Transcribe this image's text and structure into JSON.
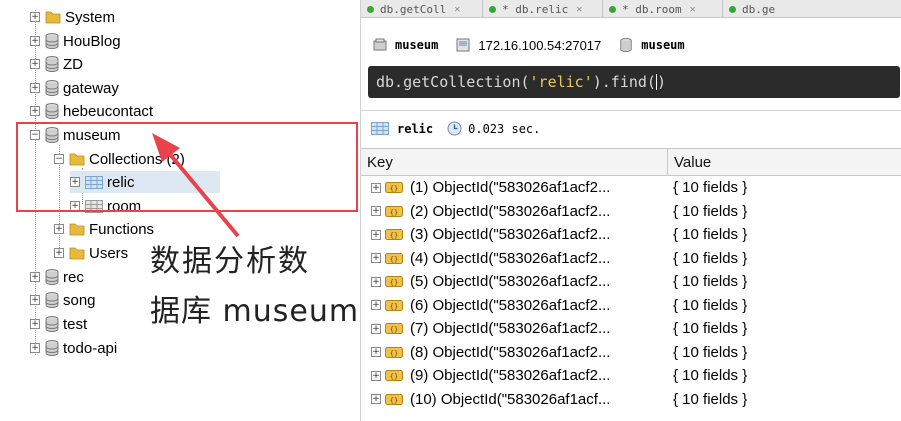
{
  "tree": {
    "nodes": [
      {
        "label": "System",
        "type": "folder",
        "expander": "+"
      },
      {
        "label": "HouBlog",
        "type": "db",
        "expander": "+"
      },
      {
        "label": "ZD",
        "type": "db",
        "expander": "+"
      },
      {
        "label": "gateway",
        "type": "db",
        "expander": "+"
      },
      {
        "label": "hebeucontact",
        "type": "db",
        "expander": "+"
      },
      {
        "label": "museum",
        "type": "db",
        "expander": "−"
      },
      {
        "label": "Collections (2)",
        "type": "folder",
        "expander": "−"
      },
      {
        "label": "relic",
        "type": "collection",
        "expander": "+"
      },
      {
        "label": "room",
        "type": "collection",
        "expander": "+"
      },
      {
        "label": "Functions",
        "type": "folder",
        "expander": "+"
      },
      {
        "label": "Users",
        "type": "folder",
        "expander": "+"
      },
      {
        "label": "rec",
        "type": "db",
        "expander": "+"
      },
      {
        "label": "song",
        "type": "db",
        "expander": "+"
      },
      {
        "label": "test",
        "type": "db",
        "expander": "+"
      },
      {
        "label": "todo-api",
        "type": "db",
        "expander": "+"
      }
    ]
  },
  "annotation": {
    "line1": "数据分析数",
    "line2": "据库 museum",
    "color": "#e8434a"
  },
  "tabs": [
    {
      "label": "db.getColl"
    },
    {
      "label": "* db.relic"
    },
    {
      "label": "* db.room"
    },
    {
      "label": "db.ge"
    }
  ],
  "connection": {
    "db_label": "museum",
    "host": "172.16.100.54:27017",
    "db_label2": "museum"
  },
  "query": {
    "prefix": "db.getCollection(",
    "string": "'relic'",
    "suffix": ").find(",
    "end": ")"
  },
  "result": {
    "collection": "relic",
    "time": "0.023 sec."
  },
  "grid": {
    "headers": {
      "key": "Key",
      "value": "Value"
    },
    "rows": [
      {
        "key": "(1) ObjectId(\"583026af1acf2...",
        "value": "{ 10 fields }"
      },
      {
        "key": "(2) ObjectId(\"583026af1acf2...",
        "value": "{ 10 fields }"
      },
      {
        "key": "(3) ObjectId(\"583026af1acf2...",
        "value": "{ 10 fields }"
      },
      {
        "key": "(4) ObjectId(\"583026af1acf2...",
        "value": "{ 10 fields }"
      },
      {
        "key": "(5) ObjectId(\"583026af1acf2...",
        "value": "{ 10 fields }"
      },
      {
        "key": "(6) ObjectId(\"583026af1acf2...",
        "value": "{ 10 fields }"
      },
      {
        "key": "(7) ObjectId(\"583026af1acf2...",
        "value": "{ 10 fields }"
      },
      {
        "key": "(8) ObjectId(\"583026af1acf2...",
        "value": "{ 10 fields }"
      },
      {
        "key": "(9) ObjectId(\"583026af1acf2...",
        "value": "{ 10 fields }"
      },
      {
        "key": "(10) ObjectId(\"583026af1acf...",
        "value": "{ 10 fields }"
      }
    ]
  },
  "colors": {
    "accent_red": "#e8434a",
    "query_bg": "#2b2b2b",
    "string_color": "#e6c85a",
    "selection": "#dde8f3"
  }
}
